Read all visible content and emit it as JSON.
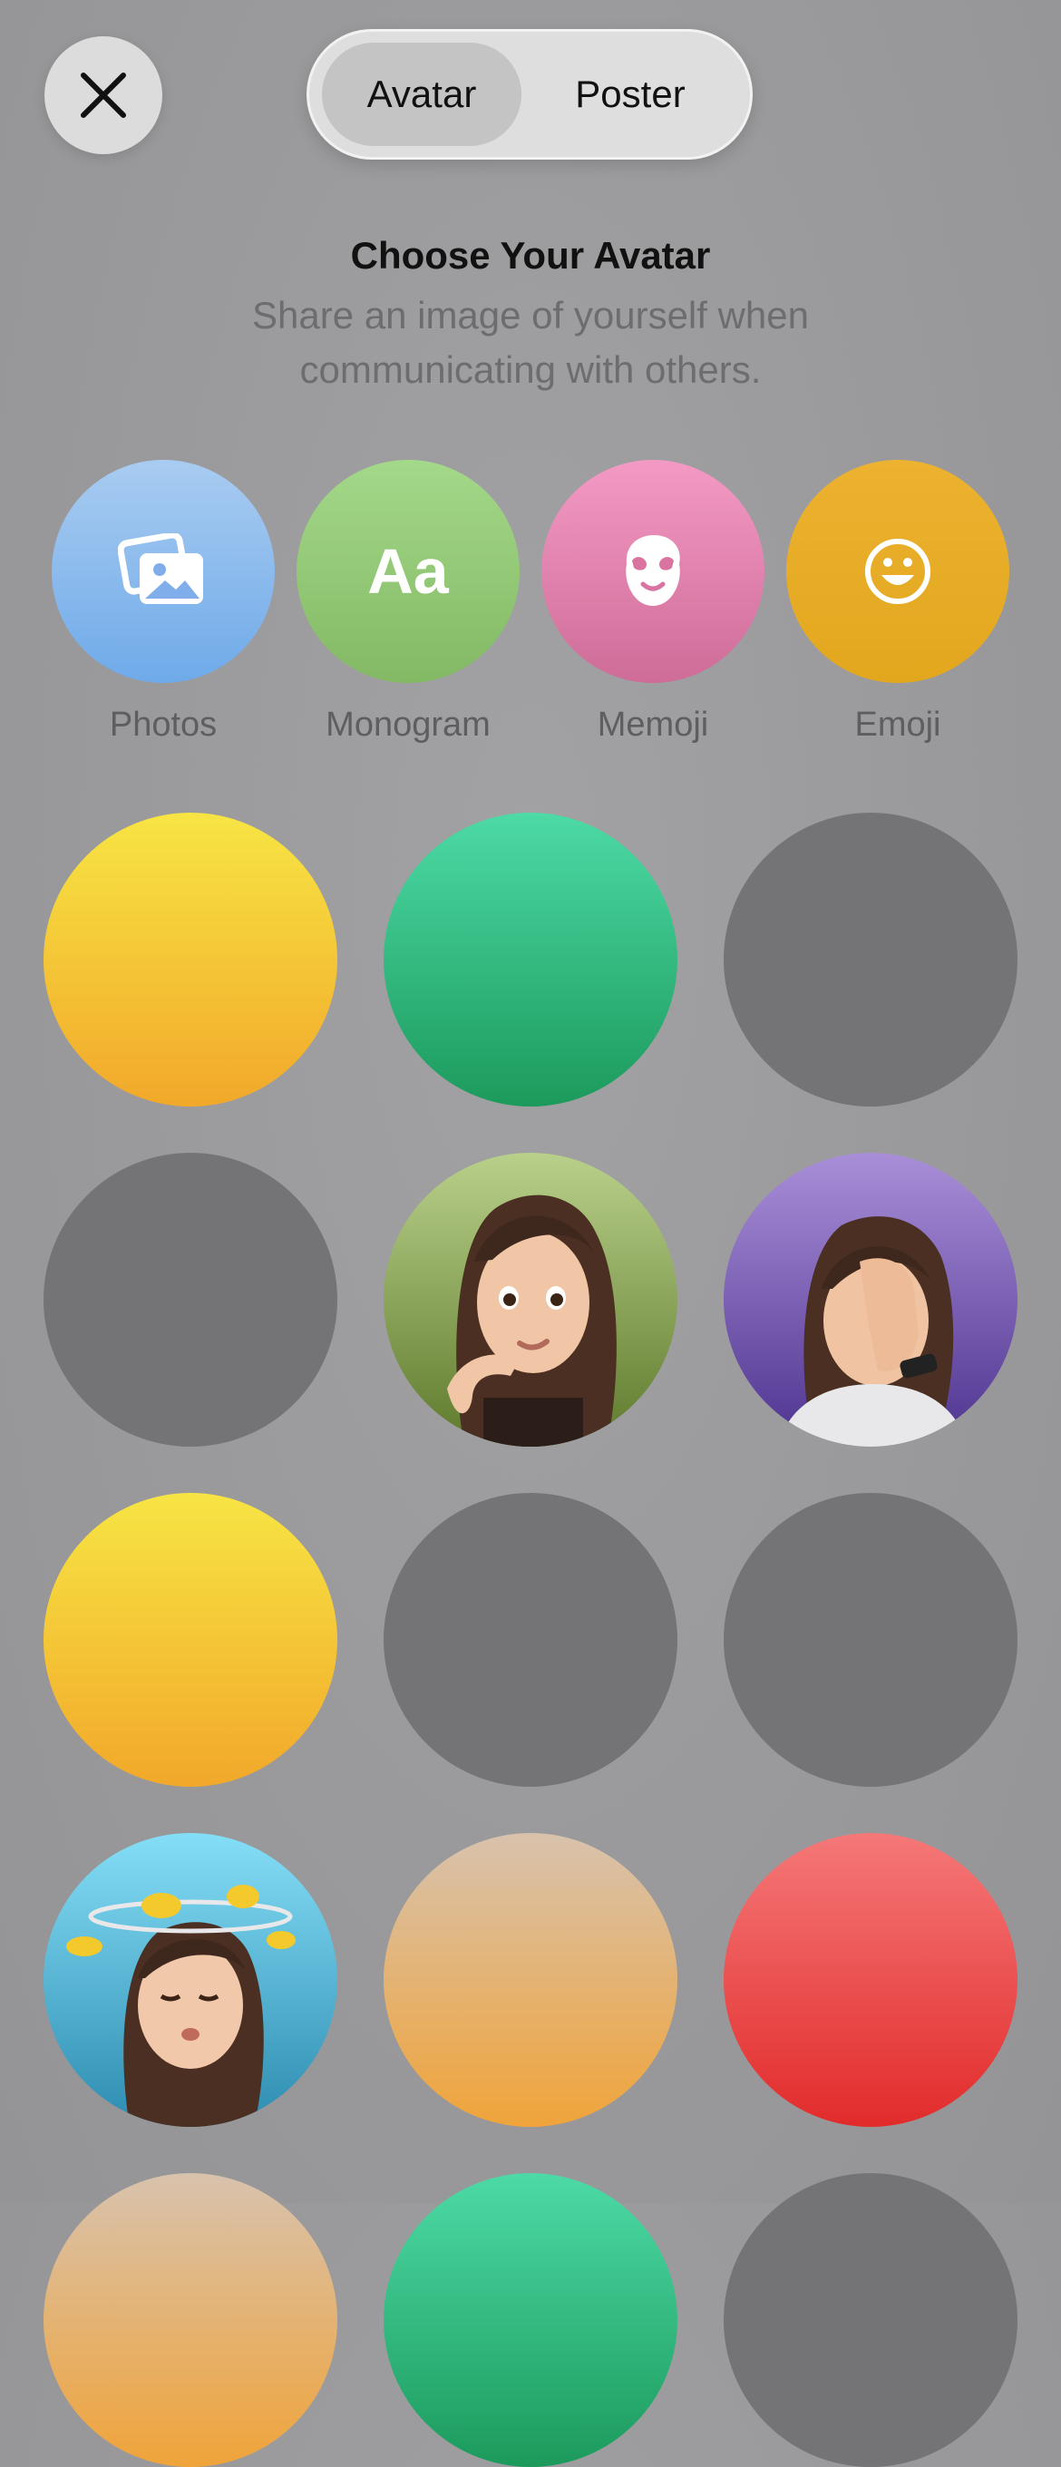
{
  "header": {
    "close_icon": "close-icon",
    "segments": [
      "Avatar",
      "Poster"
    ],
    "selected_segment": "Avatar"
  },
  "intro": {
    "title": "Choose Your Avatar",
    "subtitle": "Share an image of yourself when communicating with others."
  },
  "options": [
    {
      "label": "Photos",
      "icon": "photos-icon",
      "color": "#7fb3ee"
    },
    {
      "label": "Monogram",
      "icon": "monogram-icon",
      "color": "#8fc56f"
    },
    {
      "label": "Memoji",
      "icon": "memoji-icon",
      "color": "#e27aa8"
    },
    {
      "label": "Emoji",
      "icon": "emoji-icon",
      "color": "#e8aa22"
    }
  ],
  "avatars": [
    {
      "kind": "color",
      "style": "yellow"
    },
    {
      "kind": "color",
      "style": "green"
    },
    {
      "kind": "empty",
      "style": "grey"
    },
    {
      "kind": "empty",
      "style": "grey"
    },
    {
      "kind": "memoji",
      "style": "olive",
      "icon": "memoji-thinking-icon"
    },
    {
      "kind": "memoji",
      "style": "purple",
      "icon": "memoji-facepalm-icon"
    },
    {
      "kind": "color",
      "style": "yellow"
    },
    {
      "kind": "empty",
      "style": "grey"
    },
    {
      "kind": "empty",
      "style": "grey"
    },
    {
      "kind": "memoji",
      "style": "sky",
      "icon": "memoji-dizzy-birds-icon"
    },
    {
      "kind": "color",
      "style": "tan"
    },
    {
      "kind": "color",
      "style": "red"
    }
  ]
}
